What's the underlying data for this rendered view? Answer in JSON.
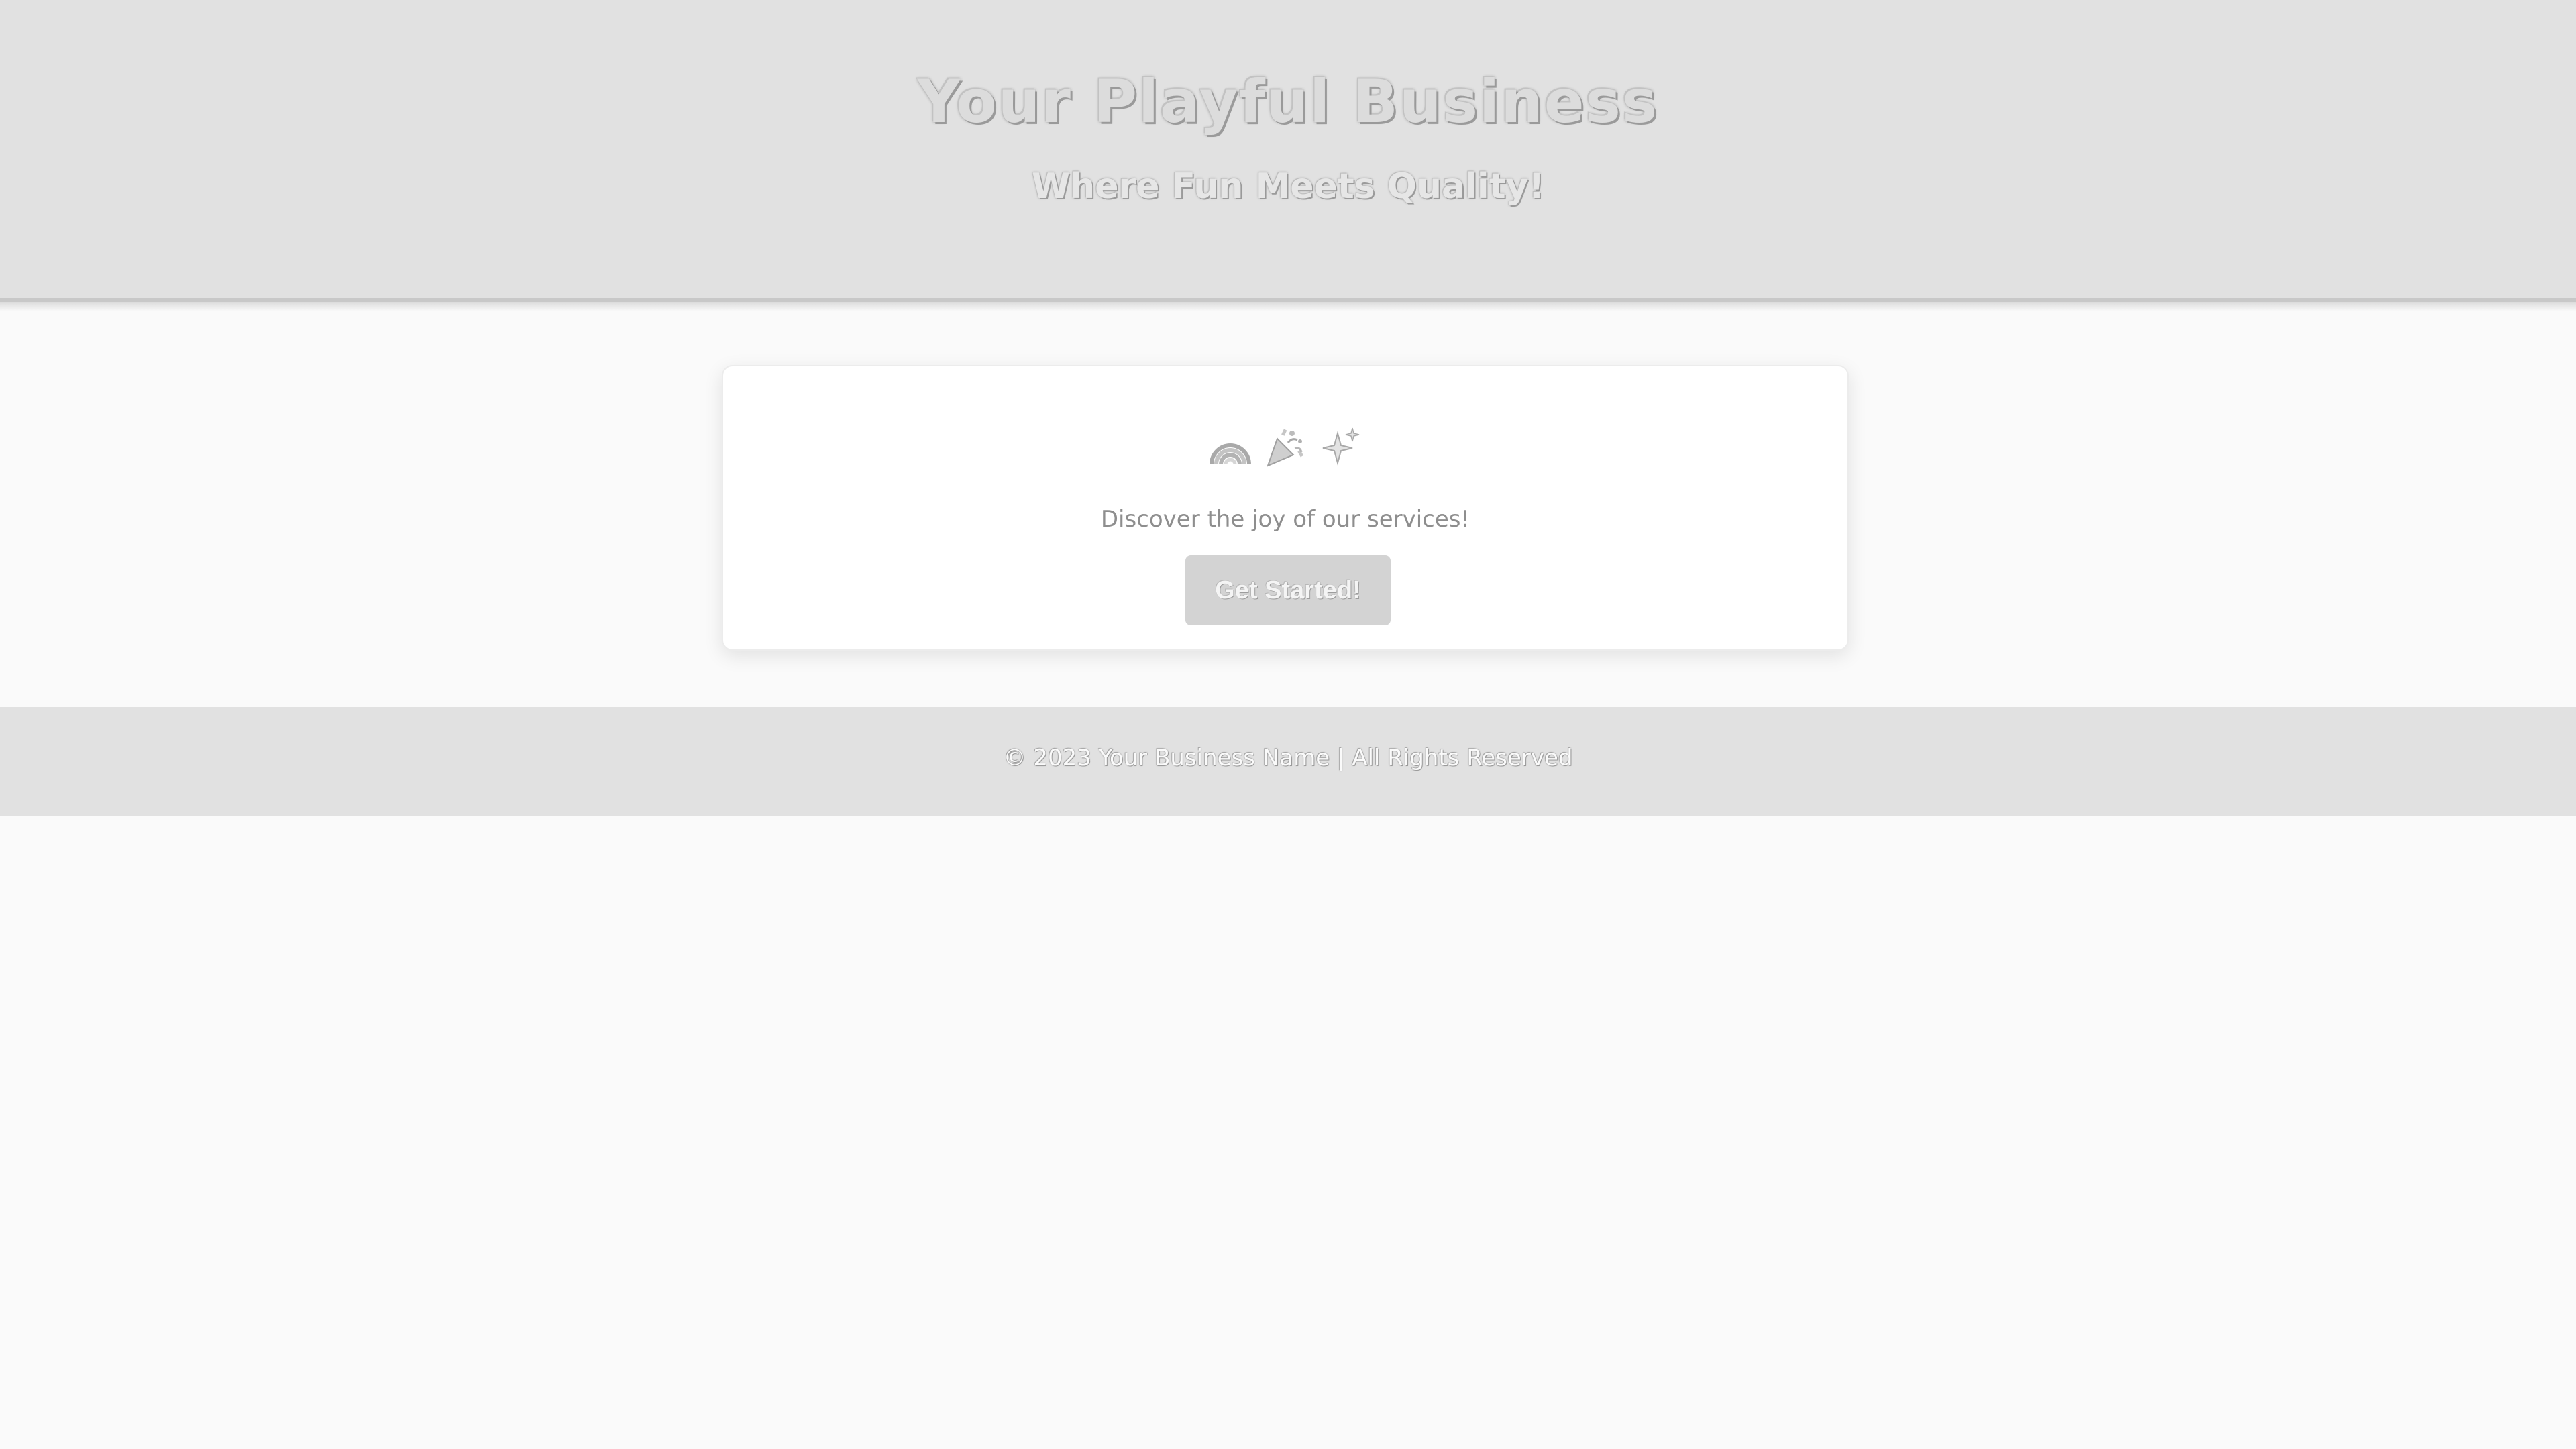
{
  "header": {
    "title": "Your Playful Business",
    "tagline": "Where Fun Meets Quality!"
  },
  "card": {
    "icons": [
      "rainbow-icon",
      "confetti-icon",
      "sparkles-icon"
    ],
    "text": "Discover the joy of our services!",
    "button_label": "Get Started!"
  },
  "footer": {
    "text": "© 2023 Your Business Name | All Rights Reserved"
  },
  "colors": {
    "header_bg": "#e1e1e1",
    "page_bg": "#fafafa",
    "button_bg": "#d3d3d3",
    "card_bg": "#ffffff"
  }
}
